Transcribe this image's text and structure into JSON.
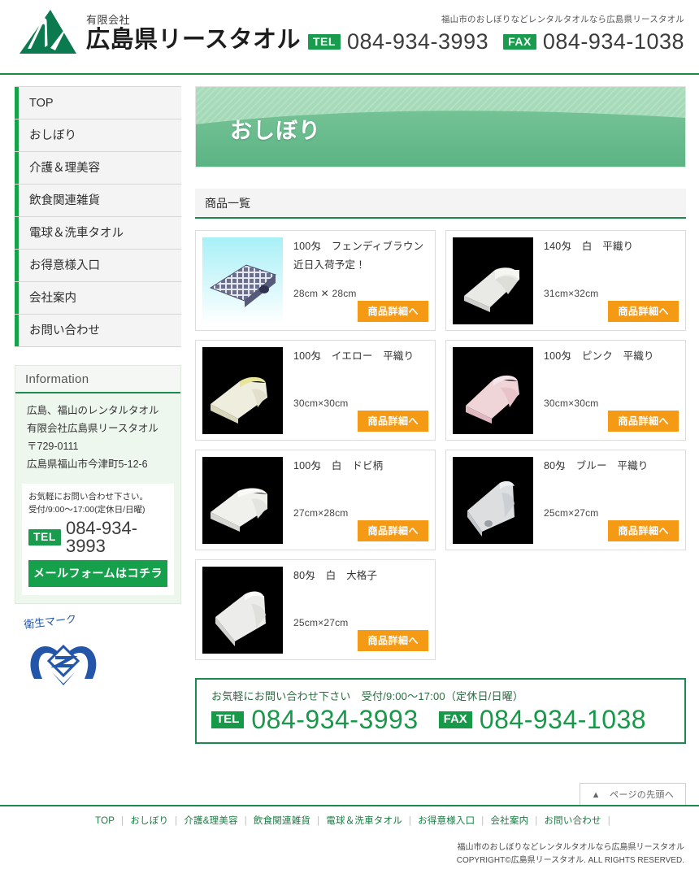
{
  "header": {
    "company_sub": "有限会社",
    "company_name": "広島県リースタオル",
    "tagline": "福山市のおしぼりなどレンタルタオルなら広島県リースタオル",
    "tel_label": "TEL",
    "tel_number": "084-934-3993",
    "fax_label": "FAX",
    "fax_number": "084-934-1038"
  },
  "sidebar": {
    "nav": [
      {
        "label": "TOP"
      },
      {
        "label": "おしぼり"
      },
      {
        "label": "介護＆理美容"
      },
      {
        "label": "飲食関連雑貨"
      },
      {
        "label": "電球＆洗車タオル"
      },
      {
        "label": "お得意様入口"
      },
      {
        "label": "会社案内"
      },
      {
        "label": "お問い合わせ"
      }
    ],
    "info": {
      "heading": "Information",
      "line1": "広島、福山のレンタルタオル",
      "line2": "有限会社広島県リースタオル",
      "line3": "〒729-0111",
      "line4": "広島県福山市今津町5-12-6",
      "note1": "お気軽にお問い合わせ下さい。",
      "note2": "受付/9:00～17:00(定休日/日曜)",
      "tel_label": "TEL",
      "tel_number": "084-934-3993",
      "mail_button": "メールフォームはコチラ"
    },
    "eisei_mark_label": "衛生マーク"
  },
  "main": {
    "banner_title": "おしぼり",
    "section_heading": "商品一覧",
    "products": [
      {
        "title": "100匁　フェンディブラウン　　近日入荷予定！",
        "size": "28cm ✕ 28cm",
        "button": "商品詳細へ",
        "image": "towel-fendi-brown"
      },
      {
        "title": "140匁　白　平織り",
        "size": "31cm×32cm",
        "button": "商品詳細へ",
        "image": "towel-white-hiraori-140"
      },
      {
        "title": "100匁　イエロー　平織り",
        "size": "30cm×30cm",
        "button": "商品詳細へ",
        "image": "towel-yellow-hiraori"
      },
      {
        "title": "100匁　ピンク　平織り",
        "size": "30cm×30cm",
        "button": "商品詳細へ",
        "image": "towel-pink-hiraori"
      },
      {
        "title": "100匁　白　ドビ柄",
        "size": "27cm×28cm",
        "button": "商品詳細へ",
        "image": "towel-white-dobi"
      },
      {
        "title": "80匁　ブルー　平織り",
        "size": "25cm×27cm",
        "button": "商品詳細へ",
        "image": "towel-blue-hiraori"
      },
      {
        "title": "80匁　白　大格子",
        "size": "25cm×27cm",
        "button": "商品詳細へ",
        "image": "towel-white-ohgoushi"
      }
    ],
    "contact_banner": {
      "text": "お気軽にお問い合わせ下さい　受付/9:00～17:00（定休日/日曜）",
      "tel_label": "TEL",
      "tel_number": "084-934-3993",
      "fax_label": "FAX",
      "fax_number": "084-934-1038"
    },
    "pagetop": "▲　ページの先頭へ"
  },
  "footer": {
    "nav": [
      {
        "label": "TOP"
      },
      {
        "label": "おしぼり"
      },
      {
        "label": "介護&理美容"
      },
      {
        "label": "飲食関連雑貨"
      },
      {
        "label": "電球＆洗車タオル"
      },
      {
        "label": "お得意様入口"
      },
      {
        "label": "会社案内"
      },
      {
        "label": "お問い合わせ"
      }
    ],
    "copy_line1": "福山市のおしぼりなどレンタルタオルなら広島県リースタオル",
    "copy_line2": "COPYRIGHT©広島県リースタオル. ALL RIGHTS RESERVED."
  },
  "colors": {
    "brand_green": "#1a8a4e",
    "accent_green": "#16a34a",
    "orange": "#f59a14",
    "banner_green": "#6cc08b"
  }
}
